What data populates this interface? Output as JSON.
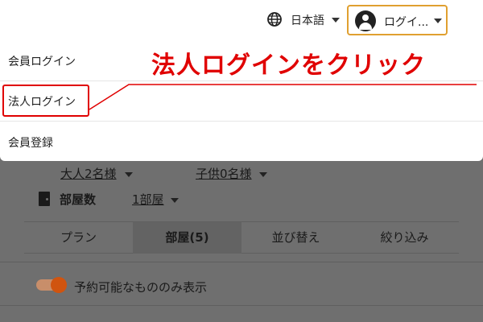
{
  "header": {
    "language": "日本語",
    "login_label": "ログイ..."
  },
  "menu": {
    "items": [
      {
        "label": "会員ログイン"
      },
      {
        "label": "法人ログイン"
      },
      {
        "label": "会員登録"
      }
    ]
  },
  "annotation": {
    "text": "法人ログインをクリック",
    "color": "#e00000"
  },
  "search": {
    "adults": "大人2名様",
    "children": "子供0名様",
    "rooms_label": "部屋数",
    "rooms_value": "1部屋"
  },
  "tabs": [
    {
      "label": "プラン"
    },
    {
      "label": "部屋(5)"
    },
    {
      "label": "並び替え"
    },
    {
      "label": "絞り込み"
    }
  ],
  "active_tab": "部屋(5)",
  "filter": {
    "toggle_label": "予約可能なもののみ表示",
    "toggle_on": true,
    "accent_color": "#d0540f"
  }
}
